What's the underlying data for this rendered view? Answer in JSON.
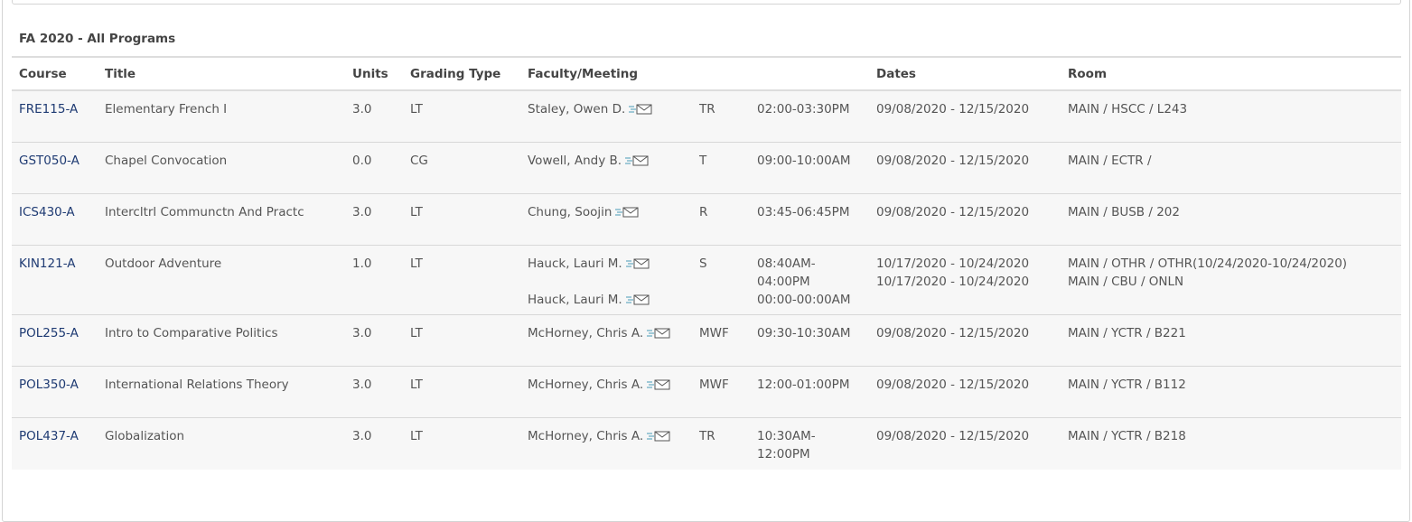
{
  "section_title": "FA 2020 - All Programs",
  "columns": {
    "course": "Course",
    "title": "Title",
    "units": "Units",
    "grading": "Grading Type",
    "faculty": "Faculty/Meeting",
    "dates": "Dates",
    "room": "Room"
  },
  "colors": {
    "link": "#1f3b73",
    "row_bg": "#f7f7f7",
    "border": "#dddddd",
    "mail_icon": "#4a9bb7"
  },
  "rows": [
    {
      "course": "FRE115-A",
      "title": "Elementary French I",
      "units": "3.0",
      "grading": "LT",
      "faculty": [
        "Staley, Owen D."
      ],
      "days": "TR",
      "time": [
        "02:00-03:30PM"
      ],
      "dates": [
        "09/08/2020 - 12/15/2020"
      ],
      "room": [
        "MAIN / HSCC / L243"
      ]
    },
    {
      "course": "GST050-A",
      "title": "Chapel Convocation",
      "units": "0.0",
      "grading": "CG",
      "faculty": [
        "Vowell, Andy B."
      ],
      "days": "T",
      "time": [
        "09:00-10:00AM"
      ],
      "dates": [
        "09/08/2020 - 12/15/2020"
      ],
      "room": [
        "MAIN / ECTR /"
      ]
    },
    {
      "course": "ICS430-A",
      "title": "Intercltrl Communctn And Practc",
      "units": "3.0",
      "grading": "LT",
      "faculty": [
        "Chung, Soojin"
      ],
      "days": "R",
      "time": [
        "03:45-06:45PM"
      ],
      "dates": [
        "09/08/2020 - 12/15/2020"
      ],
      "room": [
        "MAIN / BUSB / 202"
      ]
    },
    {
      "course": "KIN121-A",
      "title": "Outdoor Adventure",
      "units": "1.0",
      "grading": "LT",
      "faculty": [
        "Hauck, Lauri M.",
        "Hauck, Lauri M."
      ],
      "days": "S",
      "time": [
        "08:40AM-",
        "04:00PM",
        "00:00-00:00AM"
      ],
      "dates": [
        "10/17/2020 - 10/24/2020",
        "10/17/2020 - 10/24/2020"
      ],
      "room": [
        "MAIN / OTHR / OTHR(10/24/2020-10/24/2020)",
        "MAIN / CBU / ONLN"
      ]
    },
    {
      "course": "POL255-A",
      "title": "Intro to Comparative Politics",
      "units": "3.0",
      "grading": "LT",
      "faculty": [
        "McHorney, Chris A."
      ],
      "days": "MWF",
      "time": [
        "09:30-10:30AM"
      ],
      "dates": [
        "09/08/2020 - 12/15/2020"
      ],
      "room": [
        "MAIN / YCTR / B221"
      ]
    },
    {
      "course": "POL350-A",
      "title": "International Relations Theory",
      "units": "3.0",
      "grading": "LT",
      "faculty": [
        "McHorney, Chris A."
      ],
      "days": "MWF",
      "time": [
        "12:00-01:00PM"
      ],
      "dates": [
        "09/08/2020 - 12/15/2020"
      ],
      "room": [
        "MAIN / YCTR / B112"
      ]
    },
    {
      "course": "POL437-A",
      "title": "Globalization",
      "units": "3.0",
      "grading": "LT",
      "faculty": [
        "McHorney, Chris A."
      ],
      "days": "TR",
      "time": [
        "10:30AM-",
        "12:00PM"
      ],
      "dates": [
        "09/08/2020 - 12/15/2020"
      ],
      "room": [
        "MAIN / YCTR / B218"
      ]
    }
  ]
}
